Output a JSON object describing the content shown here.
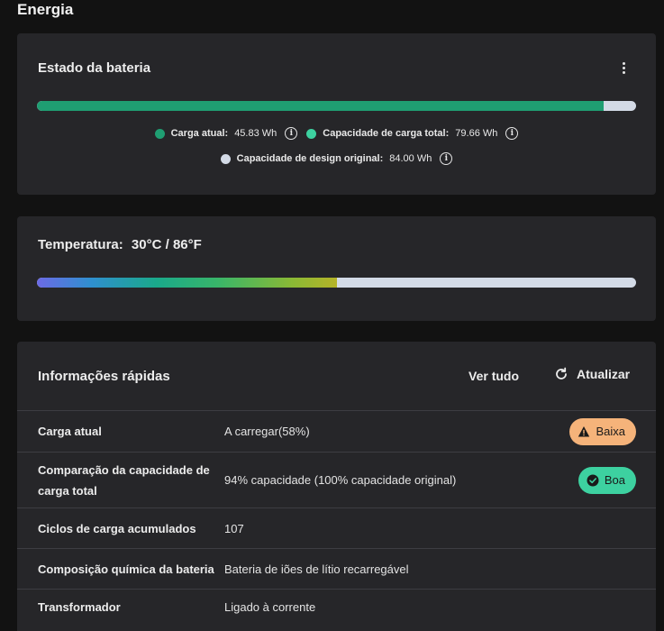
{
  "page": {
    "title": "Energia"
  },
  "battery": {
    "title": "Estado da bateria",
    "menu_icon": "kebab-menu-icon",
    "charge_fraction": 0.946,
    "legend": {
      "current": {
        "label": "Carga atual:",
        "value": "45.83 Wh",
        "color": "#1f9e72"
      },
      "full": {
        "label": "Capacidade de carga total:",
        "value": "79.66 Wh",
        "color": "#3dd1a0"
      },
      "design": {
        "label": "Capacidade de design original:",
        "value": "84.00 Wh",
        "color": "#d3dae6"
      }
    }
  },
  "temperature": {
    "label": "Temperatura:",
    "value": "30°C / 86°F",
    "fraction": 0.5
  },
  "info": {
    "title": "Informações rápidas",
    "view_all": "Ver tudo",
    "refresh": "Atualizar",
    "rows": [
      {
        "key": "Carga atual",
        "value": "A carregar(58%)",
        "badge": "Baixa",
        "badge_type": "warn"
      },
      {
        "key": "Comparação da capacidade de carga total",
        "value": "94% capacidade (100% capacidade original)",
        "badge": "Boa",
        "badge_type": "ok"
      },
      {
        "key": "Ciclos de carga acumulados",
        "value": "107"
      },
      {
        "key": "Composição química da bateria",
        "value": "Bateria de iões de lítio recarregável"
      },
      {
        "key": "Transformador",
        "value": "Ligado à corrente"
      }
    ]
  },
  "colors": {
    "background": "#121212",
    "card": "#262629",
    "warn": "#f5b37a",
    "ok": "#3dd1a0"
  }
}
